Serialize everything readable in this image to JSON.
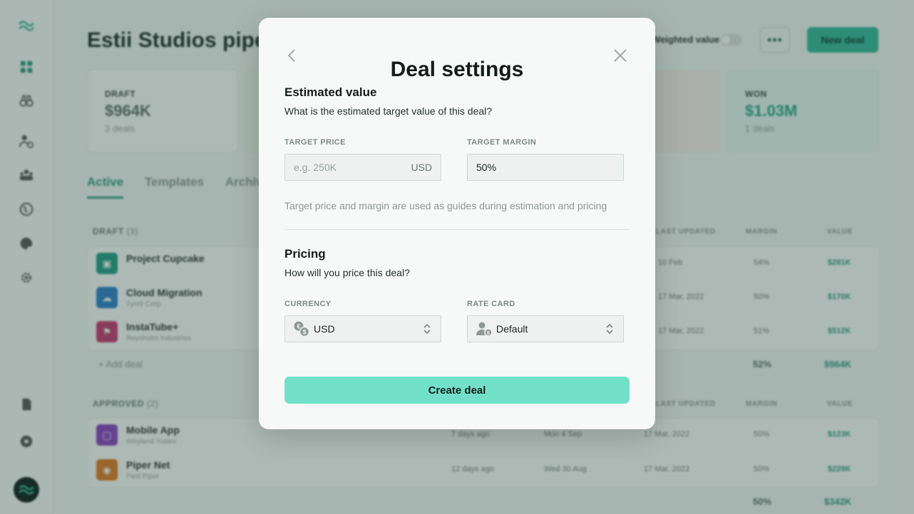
{
  "app": {
    "page_title": "Estii Studios pipeline",
    "weighted_label": "Weighted value",
    "new_deal_label": "New deal",
    "more_label": "•••",
    "stats": [
      {
        "label": "DRAFT",
        "value": "$964K",
        "sub": "3 deals"
      },
      {
        "label": "",
        "value": "",
        "sub": ""
      },
      {
        "label": "",
        "value": "",
        "sub": ""
      },
      {
        "label": "WON",
        "value": "$1.03M",
        "sub": "1 deals"
      }
    ],
    "tabs": [
      "Active",
      "Templates",
      "Archived"
    ],
    "columns": {
      "updated": "LAST UPDATED",
      "margin": "MARGIN",
      "value": "VALUE"
    },
    "draft": {
      "title": "DRAFT",
      "count": "(3)",
      "rows": [
        {
          "name": "Project Cupcake",
          "client": "",
          "updated": "10 Feb",
          "margin": "54%",
          "value": "$281K",
          "color": "#1e9e86"
        },
        {
          "name": "Cloud Migration",
          "client": "Tyrell Corp",
          "updated": "17 Mar, 2022",
          "margin": "50%",
          "value": "$170K",
          "color": "#2a7fc9"
        },
        {
          "name": "InstaTube+",
          "client": "Reyoholm Industries",
          "updated": "17 Mar, 2022",
          "margin": "51%",
          "value": "$512K",
          "color": "#c9356e"
        }
      ],
      "add_label": "+  Add deal",
      "total_margin": "52%",
      "total_value": "$964K"
    },
    "approved": {
      "title": "APPROVED",
      "count": "(2)",
      "rows": [
        {
          "name": "Mobile App",
          "client": "Weyland-Yutani",
          "age": "7 days ago",
          "date": "Mon 4 Sep",
          "updated": "17 Mar, 2022",
          "margin": "50%",
          "value": "$123K",
          "color": "#8a3fc1"
        },
        {
          "name": "Piper Net",
          "client": "Pied Piper",
          "age": "12 days ago",
          "date": "Wed 30 Aug",
          "updated": "17 Mar, 2022",
          "margin": "50%",
          "value": "$229K",
          "color": "#e07a1f"
        }
      ],
      "total_margin": "50%",
      "total_value": "$342K"
    }
  },
  "modal": {
    "title": "Deal settings",
    "estimated": {
      "title": "Estimated value",
      "subtitle": "What is the estimated target value of this deal?",
      "price_label": "TARGET PRICE",
      "price_placeholder": "e.g. 250K",
      "price_suffix": "USD",
      "margin_label": "TARGET MARGIN",
      "margin_value": "50%",
      "hint": "Target price and margin are used as guides during estimation and pricing"
    },
    "pricing": {
      "title": "Pricing",
      "subtitle": "How will you price this deal?",
      "currency_label": "CURRENCY",
      "currency_value": "USD",
      "rate_label": "RATE CARD",
      "rate_value": "Default"
    },
    "create_label": "Create deal"
  },
  "colors": {
    "accent": "#72e0c9",
    "brand": "#2a9a80"
  }
}
